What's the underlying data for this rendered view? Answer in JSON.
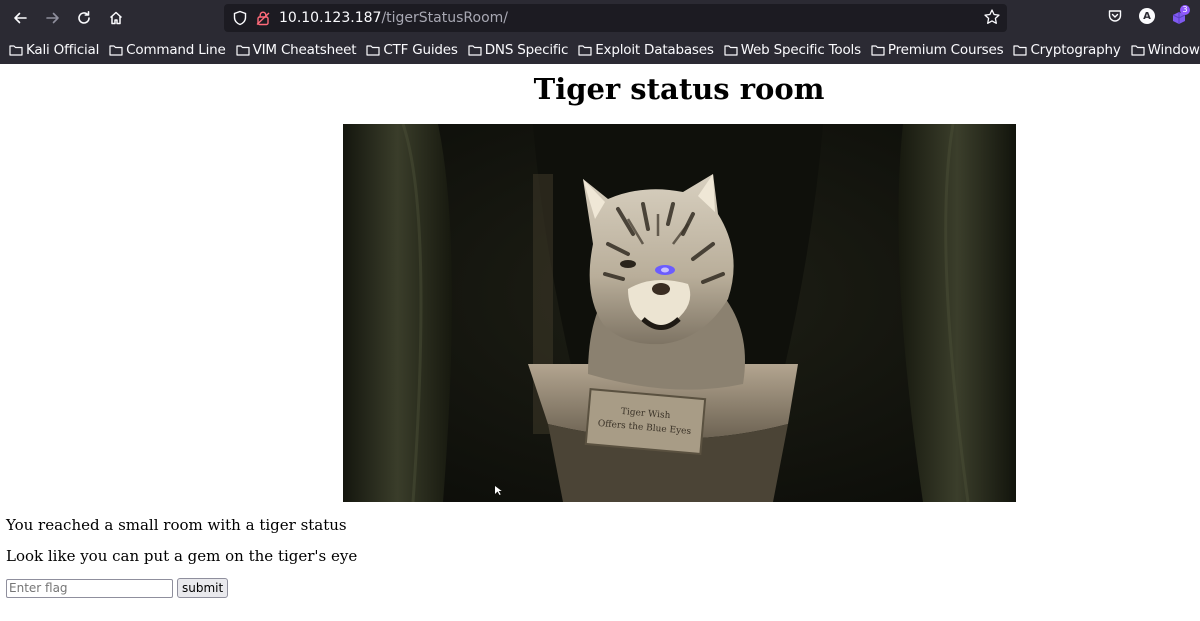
{
  "browser": {
    "url_host": "10.10.123.187",
    "url_path": "/tigerStatusRoom/",
    "extension_badge": "3",
    "account_initial": "A",
    "bookmarks": [
      {
        "label": "Kali Official"
      },
      {
        "label": "Command Line"
      },
      {
        "label": "VIM Cheatsheet"
      },
      {
        "label": "CTF Guides"
      },
      {
        "label": "DNS Specific"
      },
      {
        "label": "Exploit Databases"
      },
      {
        "label": "Web Specific Tools"
      },
      {
        "label": "Premium Courses"
      },
      {
        "label": "Cryptography"
      },
      {
        "label": "Windows Gu"
      }
    ]
  },
  "page": {
    "title": "Tiger status room",
    "image_plaque_text": "Tiger Wish Offers the Blue Eyes",
    "paragraph1": "You reached a small room with a tiger status",
    "paragraph2": "Look like you can put a gem on the tiger's eye",
    "flag_input": {
      "placeholder": "Enter flag",
      "value": ""
    },
    "submit_label": "submit"
  },
  "colors": {
    "chrome_bg": "#2b2a33",
    "urlbar_bg": "#1c1b22",
    "tiger_eye": "#6b5cff"
  }
}
